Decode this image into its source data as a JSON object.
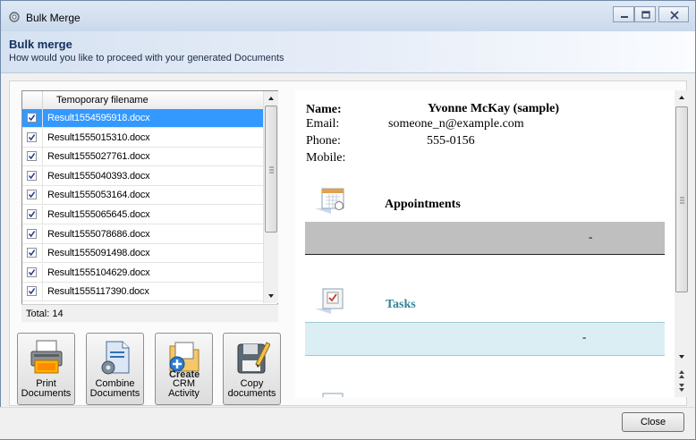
{
  "window": {
    "title": "Bulk Merge"
  },
  "header": {
    "title": "Bulk merge",
    "subtitle": "How would you like to proceed with your generated Documents"
  },
  "file_list": {
    "column_header": "Temoporary filename",
    "rows": [
      {
        "name": "Result1554595918.docx",
        "checked": true,
        "selected": true
      },
      {
        "name": "Result1555015310.docx",
        "checked": true,
        "selected": false
      },
      {
        "name": "Result1555027761.docx",
        "checked": true,
        "selected": false
      },
      {
        "name": "Result1555040393.docx",
        "checked": true,
        "selected": false
      },
      {
        "name": "Result1555053164.docx",
        "checked": true,
        "selected": false
      },
      {
        "name": "Result1555065645.docx",
        "checked": true,
        "selected": false
      },
      {
        "name": "Result1555078686.docx",
        "checked": true,
        "selected": false
      },
      {
        "name": "Result1555091498.docx",
        "checked": true,
        "selected": false
      },
      {
        "name": "Result1555104629.docx",
        "checked": true,
        "selected": false
      },
      {
        "name": "Result1555117390.docx",
        "checked": true,
        "selected": false
      }
    ],
    "total_label": "Total:",
    "total_value": "14"
  },
  "actions": [
    {
      "label_line1": "Print",
      "label_line2": "Documents",
      "icon": "printer-icon"
    },
    {
      "label_line1": "Combine",
      "label_line2": "Documents",
      "icon": "combine-documents-icon"
    },
    {
      "label_line1": "CRM",
      "label_line2": "Activity",
      "icon": "crm-activity-icon",
      "overlay": "Create"
    },
    {
      "label_line1": "Copy",
      "label_line2": "documents",
      "icon": "copy-documents-icon"
    }
  ],
  "preview": {
    "name_label": "Name:",
    "name_value": "Yvonne McKay (sample)",
    "email_label": "Email:",
    "email_value": "someone_n@example.com",
    "phone_label": "Phone:",
    "phone_value": "555-0156",
    "mobile_label": "Mobile:",
    "appointments_title": "Appointments",
    "appointments_value": "-",
    "tasks_title": "Tasks",
    "tasks_value": "-"
  },
  "colors": {
    "accent": "#3399ff",
    "tasks_title": "#31849b",
    "tasks_bar": "#daeef3",
    "appointments_bar": "#bfbfbf"
  },
  "footer": {
    "close_label": "Close"
  }
}
